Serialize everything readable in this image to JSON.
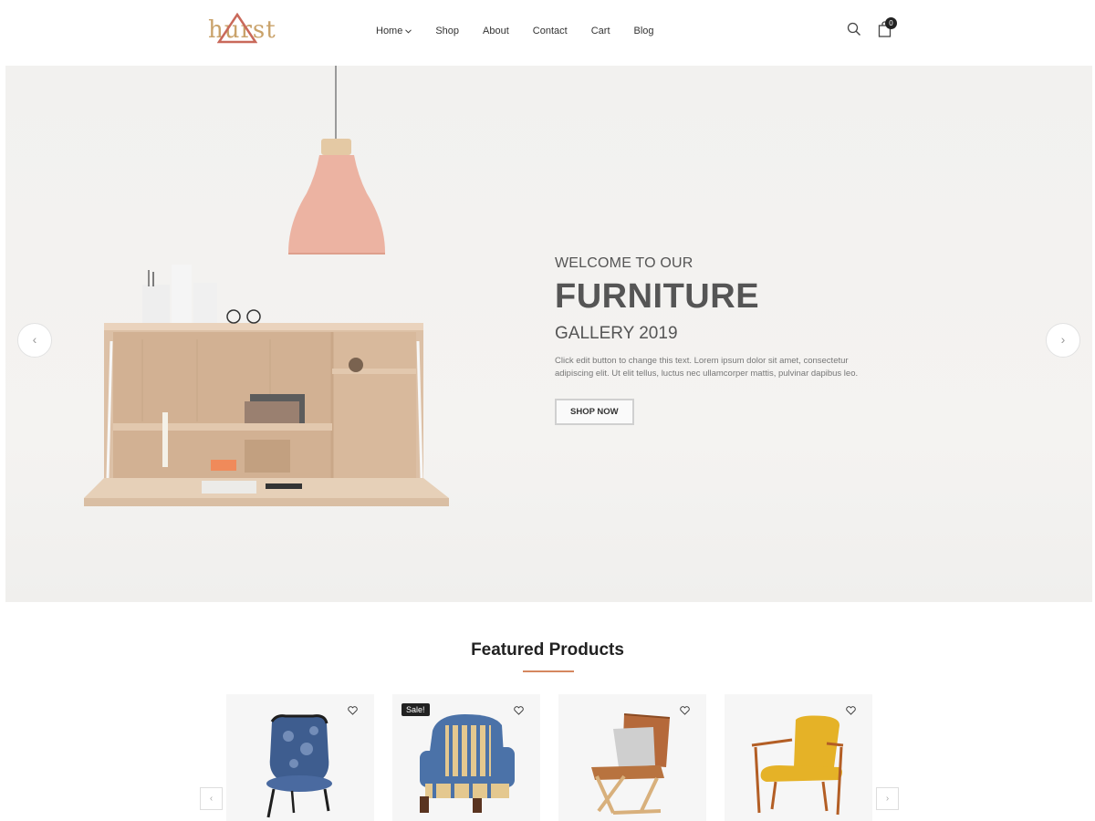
{
  "logo": {
    "text": "hurst"
  },
  "nav": {
    "items": [
      {
        "label": "Home",
        "has_dropdown": true
      },
      {
        "label": "Shop"
      },
      {
        "label": "About"
      },
      {
        "label": "Contact"
      },
      {
        "label": "Cart"
      },
      {
        "label": "Blog"
      }
    ],
    "dropdown_icon": "chevron-down-icon"
  },
  "header_icons": {
    "search": "search-icon",
    "cart": "shopping-bag-icon",
    "cart_count": "0"
  },
  "hero": {
    "welcome": "WELCOME TO OUR",
    "title": "FURNITURE",
    "subtitle": "GALLERY 2019",
    "description": "Click edit button to change this text. Lorem ipsum dolor sit amet, consectetur adipiscing elit. Ut elit tellus, luctus nec ullamcorper mattis, pulvinar dapibus leo.",
    "button_label": "SHOP NOW",
    "prev_arrow": "‹",
    "next_arrow": "›"
  },
  "featured": {
    "title": "Featured Products",
    "products": [
      {
        "badge": "",
        "wishlist_icon": "heart-icon"
      },
      {
        "badge": "Sale!",
        "wishlist_icon": "heart-icon"
      },
      {
        "badge": "",
        "wishlist_icon": "heart-icon"
      },
      {
        "badge": "",
        "wishlist_icon": "heart-icon"
      }
    ],
    "prev_arrow": "‹",
    "next_arrow": "›"
  },
  "colors": {
    "accent": "#d5875f",
    "logo": "#c9a26a",
    "text": "#555555",
    "badge_bg": "#222222"
  }
}
